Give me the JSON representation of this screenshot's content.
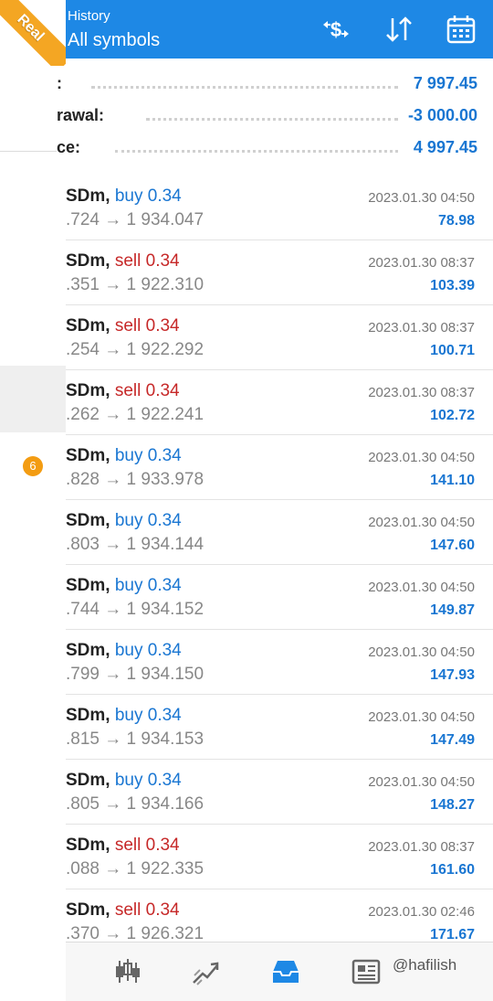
{
  "account_ribbon": "Real",
  "header": {
    "title": "History",
    "subtitle": "All symbols"
  },
  "summary": [
    {
      "label": ":",
      "value": "7 997.45"
    },
    {
      "label": "rawal:",
      "value": "-3 000.00"
    },
    {
      "label": "ce:",
      "value": "4 997.45"
    }
  ],
  "drawer": {
    "badge": "6"
  },
  "deals": [
    {
      "symbol": "SDm,",
      "side": "buy",
      "side_label": "buy 0.34",
      "prices": ".724 → 1 934.047",
      "time": "2023.01.30 04:50",
      "profit": "78.98"
    },
    {
      "symbol": "SDm,",
      "side": "sell",
      "side_label": "sell 0.34",
      "prices": ".351 → 1 922.310",
      "time": "2023.01.30 08:37",
      "profit": "103.39"
    },
    {
      "symbol": "SDm,",
      "side": "sell",
      "side_label": "sell 0.34",
      "prices": ".254 → 1 922.292",
      "time": "2023.01.30 08:37",
      "profit": "100.71"
    },
    {
      "symbol": "SDm,",
      "side": "sell",
      "side_label": "sell 0.34",
      "prices": ".262 → 1 922.241",
      "time": "2023.01.30 08:37",
      "profit": "102.72"
    },
    {
      "symbol": "SDm,",
      "side": "buy",
      "side_label": "buy 0.34",
      "prices": ".828 → 1 933.978",
      "time": "2023.01.30 04:50",
      "profit": "141.10"
    },
    {
      "symbol": "SDm,",
      "side": "buy",
      "side_label": "buy 0.34",
      "prices": ".803 → 1 934.144",
      "time": "2023.01.30 04:50",
      "profit": "147.60"
    },
    {
      "symbol": "SDm,",
      "side": "buy",
      "side_label": "buy 0.34",
      "prices": ".744 → 1 934.152",
      "time": "2023.01.30 04:50",
      "profit": "149.87"
    },
    {
      "symbol": "SDm,",
      "side": "buy",
      "side_label": "buy 0.34",
      "prices": ".799 → 1 934.150",
      "time": "2023.01.30 04:50",
      "profit": "147.93"
    },
    {
      "symbol": "SDm,",
      "side": "buy",
      "side_label": "buy 0.34",
      "prices": ".815 → 1 934.153",
      "time": "2023.01.30 04:50",
      "profit": "147.49"
    },
    {
      "symbol": "SDm,",
      "side": "buy",
      "side_label": "buy 0.34",
      "prices": ".805 → 1 934.166",
      "time": "2023.01.30 04:50",
      "profit": "148.27"
    },
    {
      "symbol": "SDm,",
      "side": "sell",
      "side_label": "sell 0.34",
      "prices": ".088 → 1 922.335",
      "time": "2023.01.30 08:37",
      "profit": "161.60"
    },
    {
      "symbol": "SDm,",
      "side": "sell",
      "side_label": "sell 0.34",
      "prices": ".370 → 1 926.321",
      "time": "2023.01.30 02:46",
      "profit": "171.67"
    }
  ],
  "icons": {
    "header": [
      "currency-exchange-icon",
      "sort-icon",
      "calendar-icon"
    ],
    "nav": [
      "quotes-icon",
      "chart-icon",
      "history-inbox-icon",
      "news-icon"
    ]
  },
  "watermark": "@hafilish",
  "colors": {
    "header_bg": "#1e88e5",
    "buy": "#1976d2",
    "sell": "#c62828",
    "ribbon": "#f4a623",
    "badge": "#f39c12"
  }
}
